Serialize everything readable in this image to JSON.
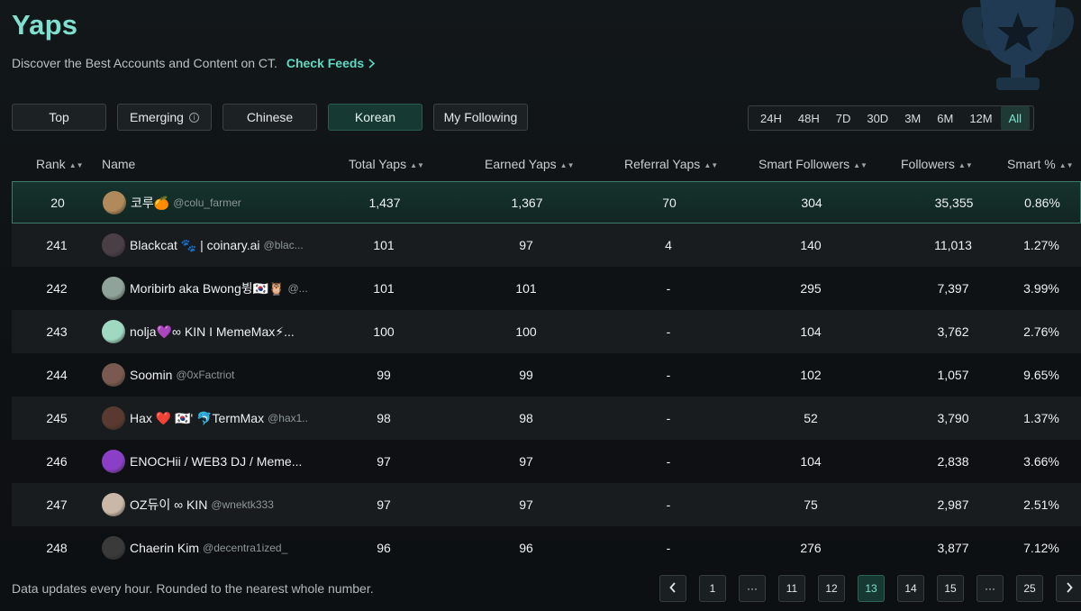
{
  "header": {
    "title": "Yaps",
    "subtitle": "Discover the Best Accounts and Content on CT.",
    "check_feeds": "Check Feeds"
  },
  "filters": [
    "Top",
    "Emerging",
    "Chinese",
    "Korean",
    "My Following"
  ],
  "active_filter": "Korean",
  "ranges": [
    "24H",
    "48H",
    "7D",
    "30D",
    "3M",
    "6M",
    "12M",
    "All"
  ],
  "active_range": "All",
  "columns": {
    "rank": "Rank",
    "name": "Name",
    "total": "Total Yaps",
    "earned": "Earned Yaps",
    "referral": "Referral Yaps",
    "smart_followers": "Smart Followers",
    "followers": "Followers",
    "smart_pct": "Smart %"
  },
  "rows": [
    {
      "rank": "20",
      "name": "코루🍊",
      "handle": "@colu_farmer",
      "total": "1,437",
      "earned": "1,367",
      "referral": "70",
      "smart_followers": "304",
      "followers": "35,355",
      "smart_pct": "0.86%",
      "avatar_color": "#b08a5a"
    },
    {
      "rank": "241",
      "name": "Blackcat 🐾 | coinary.ai",
      "handle": "@blac...",
      "total": "101",
      "earned": "97",
      "referral": "4",
      "smart_followers": "140",
      "followers": "11,013",
      "smart_pct": "1.27%",
      "avatar_color": "#4a3f44"
    },
    {
      "rank": "242",
      "name": "Moribirb aka Bwong뷩🇰🇷🦉",
      "handle": "@...",
      "total": "101",
      "earned": "101",
      "referral": "-",
      "smart_followers": "295",
      "followers": "7,397",
      "smart_pct": "3.99%",
      "avatar_color": "#8fa39a"
    },
    {
      "rank": "243",
      "name": "nolja💜∞ KIN I MemeMax⚡...",
      "handle": "",
      "total": "100",
      "earned": "100",
      "referral": "-",
      "smart_followers": "104",
      "followers": "3,762",
      "smart_pct": "2.76%",
      "avatar_color": "#9fd9c2"
    },
    {
      "rank": "244",
      "name": "Soomin",
      "handle": "@0xFactriot",
      "total": "99",
      "earned": "99",
      "referral": "-",
      "smart_followers": "102",
      "followers": "1,057",
      "smart_pct": "9.65%",
      "avatar_color": "#7a5a50"
    },
    {
      "rank": "245",
      "name": "Hax ❤️ 🇰🇷' 🐬TermMax",
      "handle": "@hax1...",
      "total": "98",
      "earned": "98",
      "referral": "-",
      "smart_followers": "52",
      "followers": "3,790",
      "smart_pct": "1.37%",
      "avatar_color": "#5a3a30"
    },
    {
      "rank": "246",
      "name": "ENOCHii / WEB3 DJ / Meme...",
      "handle": "",
      "total": "97",
      "earned": "97",
      "referral": "-",
      "smart_followers": "104",
      "followers": "2,838",
      "smart_pct": "3.66%",
      "avatar_color": "#8b3fc7"
    },
    {
      "rank": "247",
      "name": "OZ듀이 ∞ KIN",
      "handle": "@wnektk333",
      "total": "97",
      "earned": "97",
      "referral": "-",
      "smart_followers": "75",
      "followers": "2,987",
      "smart_pct": "2.51%",
      "avatar_color": "#c9b8a8"
    },
    {
      "rank": "248",
      "name": "Chaerin Kim",
      "handle": "@decentra1ized_",
      "total": "96",
      "earned": "96",
      "referral": "-",
      "smart_followers": "276",
      "followers": "3,877",
      "smart_pct": "7.12%",
      "avatar_color": "#3a3a3a"
    }
  ],
  "footer": {
    "note": "Data updates every hour. Rounded to the nearest whole number."
  },
  "pagination": {
    "prev": "‹",
    "pages": [
      "1",
      "···",
      "11",
      "12",
      "13",
      "14",
      "15",
      "···",
      "25"
    ],
    "active": "13",
    "next": "›"
  },
  "colors": {
    "accent": "#7fe0cf",
    "highlight_border": "#3d7a6c",
    "background": "#0f1315"
  },
  "icons": [
    "info-icon",
    "chevron-right-icon",
    "sort-icon",
    "trophy-icon",
    "chevron-left-icon"
  ]
}
